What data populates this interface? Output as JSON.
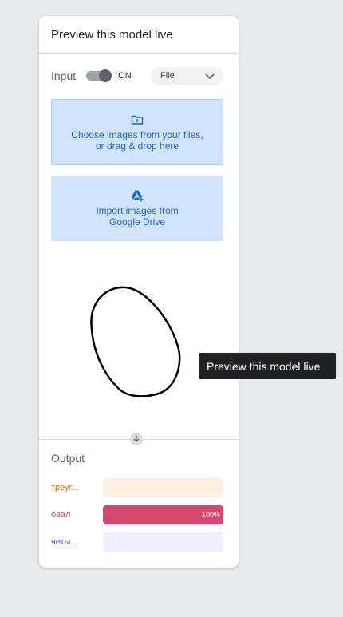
{
  "panel": {
    "title": "Preview this model live",
    "input_label": "Input",
    "toggle_state": "ON",
    "source_select": {
      "value": "File"
    },
    "upload_zone": {
      "line1": "Choose images from your files,",
      "line2": "or drag & drop here"
    },
    "drive_zone": {
      "line1": "Import images from",
      "line2": "Google Drive"
    },
    "output_label": "Output",
    "classes": [
      {
        "label": "треуг...",
        "percent": 0,
        "percent_label": "",
        "color": "#e8710a",
        "track": "#feefe3"
      },
      {
        "label": "овал",
        "percent": 100,
        "percent_label": "100%",
        "color": "#d5486d",
        "track": "#fce8ed"
      },
      {
        "label": "четы...",
        "percent": 0,
        "percent_label": "",
        "color": "#6d4ccf",
        "track": "#efeefe"
      }
    ]
  },
  "tooltip": {
    "text": "Preview this model live"
  },
  "colors": {
    "accent": "#1967d2",
    "zone_bg": "#d2e3fc",
    "background": "#e8eaed"
  }
}
